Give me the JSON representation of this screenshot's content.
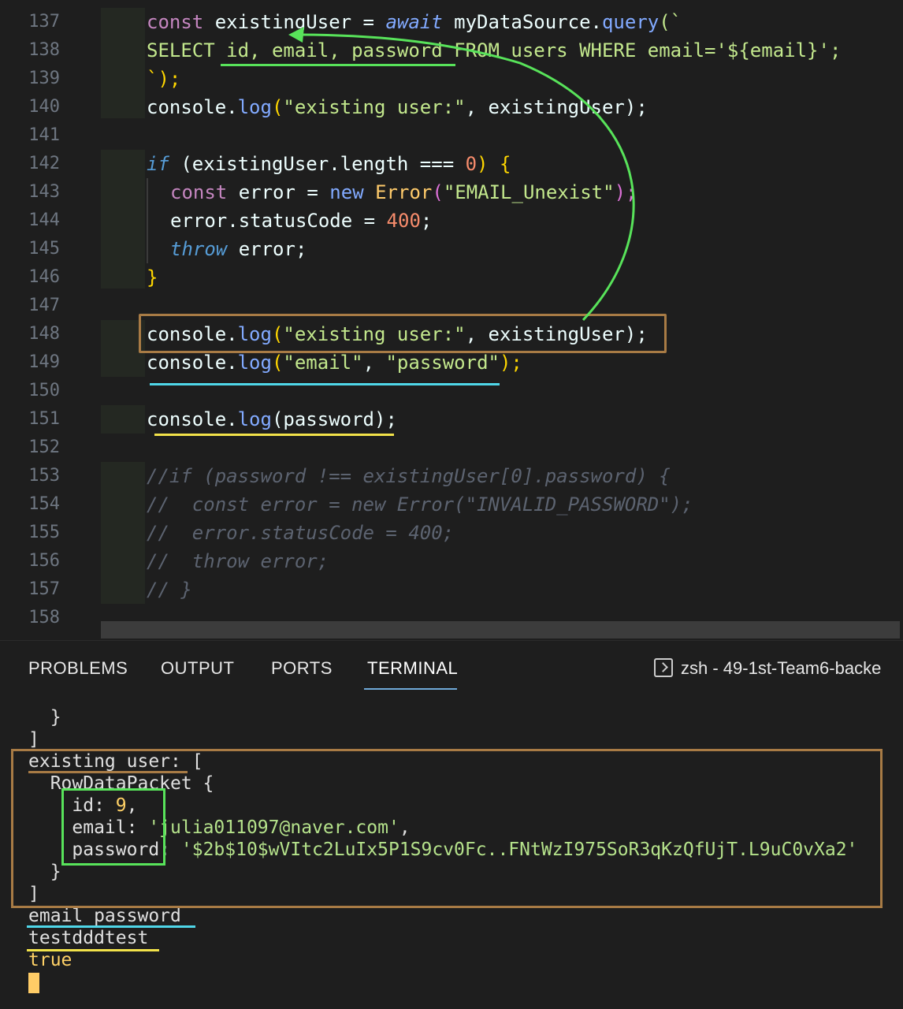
{
  "editor": {
    "lines": [
      {
        "n": "137"
      },
      {
        "n": "138"
      },
      {
        "n": "139"
      },
      {
        "n": "140"
      },
      {
        "n": "141"
      },
      {
        "n": "142"
      },
      {
        "n": "143"
      },
      {
        "n": "144"
      },
      {
        "n": "145"
      },
      {
        "n": "146"
      },
      {
        "n": "147"
      },
      {
        "n": "148"
      },
      {
        "n": "149"
      },
      {
        "n": "150"
      },
      {
        "n": "151"
      },
      {
        "n": "152"
      },
      {
        "n": "153"
      },
      {
        "n": "154"
      },
      {
        "n": "155"
      },
      {
        "n": "156"
      },
      {
        "n": "157"
      },
      {
        "n": "158"
      }
    ],
    "code": {
      "l137": {
        "a": "const",
        "b": " existingUser = ",
        "c": "await",
        "d": " myDataSource.",
        "e": "query",
        "f": "(`"
      },
      "l138": "SELECT id, email, password FROM users WHERE email='${email}';",
      "l139": "`);",
      "l140": {
        "a": "console.",
        "b": "log",
        "c": "(",
        "d": "\"existing user:\"",
        "e": ", existingUser);"
      },
      "l142": {
        "a": "if",
        "b": " (existingUser.length === ",
        "c": "0",
        "d": ") {"
      },
      "l143": {
        "a": "const",
        "b": " error = ",
        "c": "new",
        "d": " Error",
        "e": "(",
        "f": "\"EMAIL_Unexist\"",
        "g": ");"
      },
      "l144": {
        "a": "error.statusCode = ",
        "b": "400",
        "c": ";"
      },
      "l145": {
        "a": "throw",
        "b": " error;"
      },
      "l146": "}",
      "l148": {
        "a": "console.",
        "b": "log",
        "c": "(",
        "d": "\"existing user:\"",
        "e": ", existingUser);"
      },
      "l149": {
        "a": "console.",
        "b": "log",
        "c": "(",
        "d": "\"email\"",
        "e": ", ",
        "f": "\"password\"",
        "g": ");"
      },
      "l151": {
        "a": "console.",
        "b": "log",
        "c": "(password);"
      },
      "l153": "//if (password !== existingUser[0].password) {",
      "l154": "//  const error = new Error(\"INVALID_PASSWORD\");",
      "l155": "//  error.statusCode = 400;",
      "l156": "//  throw error;",
      "l157": "// }"
    }
  },
  "panel": {
    "tabs": [
      "PROBLEMS",
      "OUTPUT",
      "PORTS",
      "TERMINAL"
    ],
    "active_tab": "TERMINAL",
    "terminal_select": "zsh - 49-1st-Team6-backe"
  },
  "terminal": {
    "lines": {
      "t1": "  }",
      "t2": "]",
      "t3": "existing user: [",
      "t4": "  RowDataPacket {",
      "t5a": "    id: ",
      "t5b": "9",
      "t5c": ",",
      "t6a": "    email: ",
      "t6b": "'julia011097@naver.com'",
      "t6c": ",",
      "t7a": "    password: ",
      "t7b": "'$2b$10$wVItc2LuIx5P1S9cv0Fc..FNtWzI975SoR3qKzQfUjT.L9uC0vXa2'",
      "t8": "  }",
      "t9": "]",
      "t10": "email password",
      "t11": "testdddtest",
      "t12": "true"
    }
  },
  "colors": {
    "annotation_orange": "#a87b45",
    "annotation_green": "#58e35a",
    "annotation_cyan": "#4fd6e8",
    "annotation_yellow": "#f2e24a"
  }
}
